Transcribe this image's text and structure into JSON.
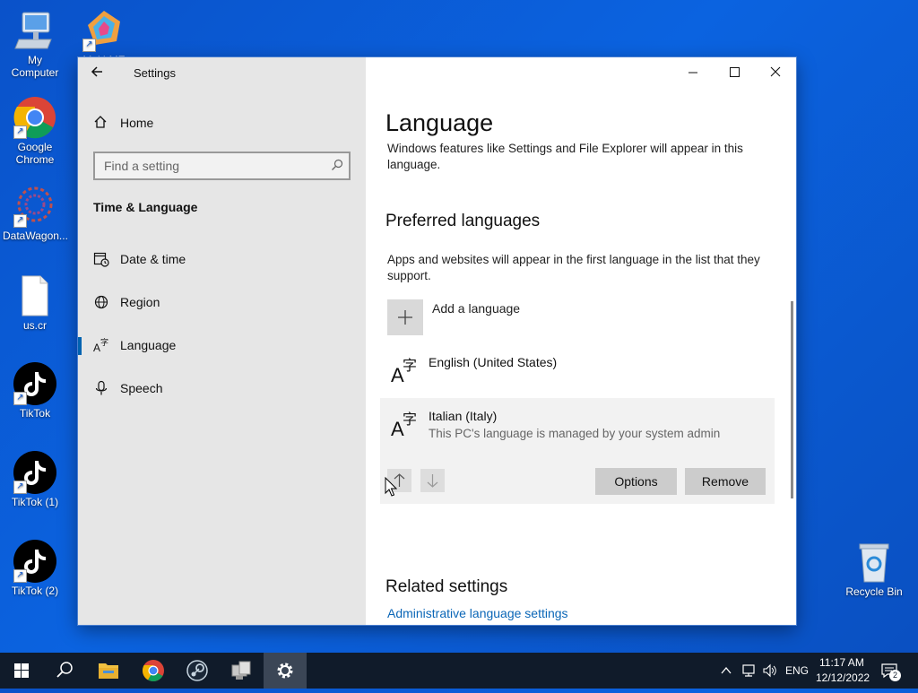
{
  "desktop": {
    "icons": [
      {
        "label": "My Computer"
      },
      {
        "label": "Multi-ME"
      },
      {
        "label": "Google Chrome"
      },
      {
        "label": "DataWagon..."
      },
      {
        "label": "us.cr"
      },
      {
        "label": "TikTok"
      },
      {
        "label": "TikTok (1)"
      },
      {
        "label": "TikTok (2)"
      },
      {
        "label": "Recycle Bin"
      }
    ]
  },
  "window": {
    "title": "Settings",
    "sidebar": {
      "home_label": "Home",
      "search_placeholder": "Find a setting",
      "section_title": "Time & Language",
      "items": [
        {
          "label": "Date & time",
          "icon": "calendar-clock-icon"
        },
        {
          "label": "Region",
          "icon": "globe-icon"
        },
        {
          "label": "Language",
          "icon": "language-icon",
          "active": true
        },
        {
          "label": "Speech",
          "icon": "microphone-icon"
        }
      ]
    },
    "main": {
      "title": "Language",
      "intro": "Windows features like Settings and File Explorer will appear in this language.",
      "preferred_title": "Preferred languages",
      "preferred_desc": "Apps and websites will appear in the first language in the list that they support.",
      "add_language": "Add a language",
      "languages": [
        {
          "name": "English (United States)",
          "sub": ""
        },
        {
          "name": "Italian (Italy)",
          "sub": "This PC's language is managed by your system admin"
        }
      ],
      "options_button": "Options",
      "remove_button": "Remove",
      "related_title": "Related settings",
      "related_link": "Administrative language settings"
    }
  },
  "taskbar": {
    "lang": "ENG",
    "time": "11:17 AM",
    "date": "12/12/2022",
    "notif_count": "2"
  },
  "colors": {
    "accent": "#0063b1",
    "link": "#0a66b7",
    "taskbar": "#101b2a"
  }
}
